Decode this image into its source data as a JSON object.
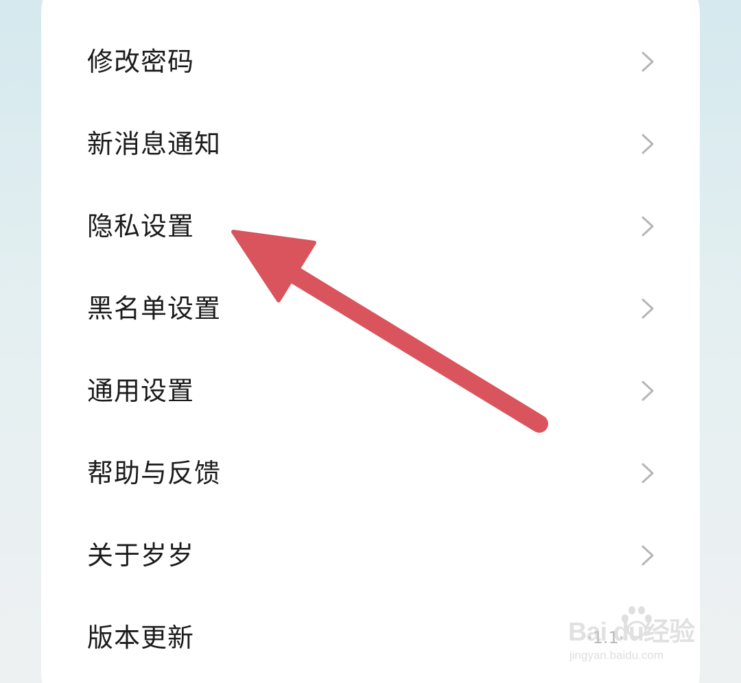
{
  "settings": {
    "items": [
      {
        "label": "修改密码"
      },
      {
        "label": "新消息通知"
      },
      {
        "label": "隐私设置"
      },
      {
        "label": "黑名单设置"
      },
      {
        "label": "通用设置"
      },
      {
        "label": "帮助与反馈"
      },
      {
        "label": "关于岁岁"
      },
      {
        "label": "版本更新",
        "value": "·1.1·"
      }
    ]
  },
  "annotation": {
    "arrow_color": "#d9545c",
    "points_to": "隐私设置"
  },
  "watermark": {
    "logo_text": "Bai  du经验",
    "url": "jingyan.baidu.com"
  },
  "colors": {
    "background": "#dcecef",
    "card": "#ffffff",
    "text": "#1b1b1b",
    "chevron": "#b5b5b5"
  }
}
